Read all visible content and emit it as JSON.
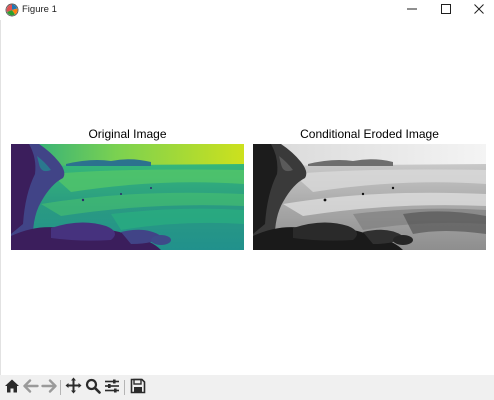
{
  "window": {
    "title": "Figure 1",
    "app_icon": "matplotlib-figure-icon",
    "controls": [
      "minimize-icon",
      "maximize-icon",
      "close-icon"
    ]
  },
  "figure": {
    "background": "#ffffff",
    "axes": [
      {
        "title": "Original Image",
        "colormap": "viridis"
      },
      {
        "title": "Conditional Eroded Image",
        "colormap": "gray"
      }
    ]
  },
  "toolbar": {
    "background": "#f0f0f0",
    "icons": [
      "home-icon",
      "back-arrow-icon",
      "forward-arrow-icon",
      "pan-icon",
      "zoom-icon",
      "configure-subplots-icon",
      "save-icon"
    ]
  },
  "colors": {
    "viridis_dark": "#3b1e5c",
    "viridis_mid": "#2ba07f",
    "viridis_light": "#cde21f",
    "toolbar_icon": "#2b2b2b"
  }
}
